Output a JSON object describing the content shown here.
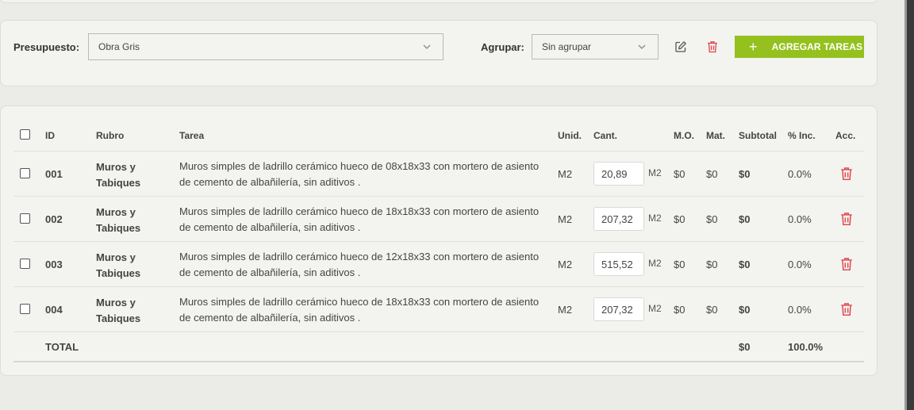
{
  "filters": {
    "presupuesto_label": "Presupuesto:",
    "presupuesto_value": "Obra Gris",
    "agrupar_label": "Agrupar:",
    "agrupar_value": "Sin agrupar",
    "add_button_label": "AGREGAR TAREAS"
  },
  "table": {
    "headers": {
      "id": "ID",
      "rubro": "Rubro",
      "tarea": "Tarea",
      "unid": "Unid.",
      "cant": "Cant.",
      "mo": "M.O.",
      "mat": "Mat.",
      "subtotal": "Subtotal",
      "inc": "% Inc.",
      "acc": "Acc."
    },
    "rows": [
      {
        "id": "001",
        "rubro": "Muros y Tabiques",
        "tarea": "Muros simples de ladrillo cerámico hueco de 08x18x33 con mortero de asiento de cemento de albañilería, sin aditivos .",
        "unid": "M2",
        "cant": "20,89",
        "cant_unit": "M2",
        "mo": "$0",
        "mat": "$0",
        "subtotal": "$0",
        "inc": "0.0%"
      },
      {
        "id": "002",
        "rubro": "Muros y Tabiques",
        "tarea": "Muros simples de ladrillo cerámico hueco de 18x18x33 con mortero de asiento de cemento de albañilería, sin aditivos .",
        "unid": "M2",
        "cant": "207,32",
        "cant_unit": "M2",
        "mo": "$0",
        "mat": "$0",
        "subtotal": "$0",
        "inc": "0.0%"
      },
      {
        "id": "003",
        "rubro": "Muros y Tabiques",
        "tarea": "Muros simples de ladrillo cerámico hueco de 12x18x33 con mortero de asiento de cemento de albañilería, sin aditivos .",
        "unid": "M2",
        "cant": "515,52",
        "cant_unit": "M2",
        "mo": "$0",
        "mat": "$0",
        "subtotal": "$0",
        "inc": "0.0%"
      },
      {
        "id": "004",
        "rubro": "Muros y Tabiques",
        "tarea": "Muros simples de ladrillo cerámico hueco de 18x18x33 con mortero de asiento de cemento de albañilería, sin aditivos .",
        "unid": "M2",
        "cant": "207,32",
        "cant_unit": "M2",
        "mo": "$0",
        "mat": "$0",
        "subtotal": "$0",
        "inc": "0.0%"
      }
    ],
    "total": {
      "label": "TOTAL",
      "subtotal": "$0",
      "inc": "100.0%"
    }
  },
  "colors": {
    "accent": "#95c11f",
    "danger": "#e0454a",
    "background": "#ebebe7",
    "card": "#f3f3f0"
  },
  "icons": [
    "chevron-down-icon",
    "edit-icon",
    "trash-icon",
    "plus-icon"
  ]
}
